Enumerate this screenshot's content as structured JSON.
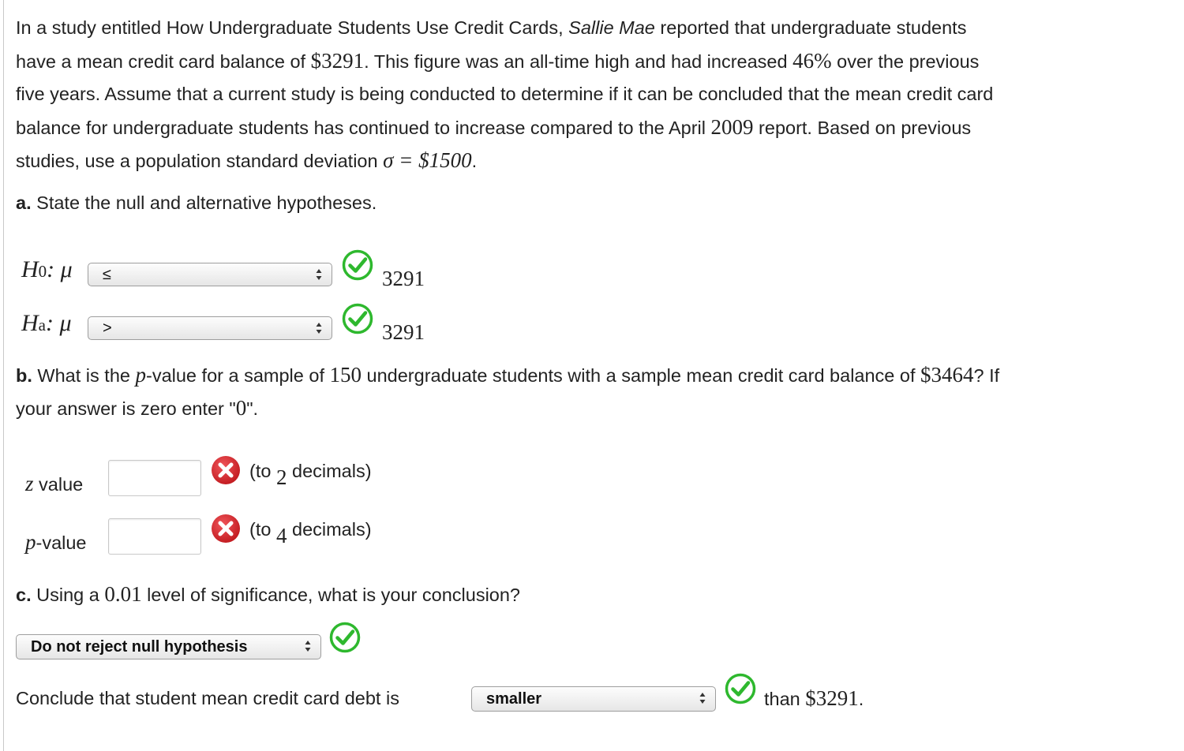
{
  "intro": {
    "l1a": "In a study entitled How Undergraduate Students Use Credit Cards, ",
    "l1b": "Sallie Mae",
    "l1c": " reported that undergraduate students",
    "l2a": "have a mean credit card balance of ",
    "l2b": "$3291",
    "l2c": ". This figure was an all-time high and had increased ",
    "l2d": "46%",
    "l2e": " over the previous",
    "l3": "five years. Assume that a current study is being conducted to determine if it can be concluded that the mean credit card",
    "l4a": "balance for undergraduate students has continued to increase compared to the April ",
    "l4b": "2009",
    "l4c": " report. Based on previous",
    "l5a": "studies, use a population standard deviation ",
    "l5b": "σ = $1500",
    "l5c": "."
  },
  "part_a": {
    "label": "a.",
    "question": " State the null and alternative hypotheses.",
    "h0": {
      "h": "H",
      "sub": "0",
      "mu": ": μ",
      "selected": "≤",
      "value": "3291",
      "status": "correct"
    },
    "ha": {
      "h": "H",
      "sub": "a",
      "mu": ": μ",
      "selected": ">",
      "value": "3291",
      "status": "correct"
    }
  },
  "part_b": {
    "label": "b.",
    "q1": " What is the ",
    "p": "p",
    "q2": "-value for a sample of ",
    "n": "150",
    "q3": " undergraduate students with a sample mean credit card balance of ",
    "mean": "$3464",
    "q4": "? If",
    "q5a": "your answer is zero enter \"",
    "q5b": "0",
    "q5c": "\".",
    "z_label_var": "z",
    "z_label": " value",
    "z_value": "",
    "z_hint_a": "(to ",
    "z_hint_n": "2",
    "z_hint_b": " decimals)",
    "z_status": "incorrect",
    "p_label_var": "p",
    "p_label": "-value",
    "p_value": "",
    "p_hint_a": "(to ",
    "p_hint_n": "4",
    "p_hint_b": " decimals)",
    "p_status": "incorrect"
  },
  "part_c": {
    "label": "c.",
    "q1": " Using a ",
    "alpha": "0.01",
    "q2": " level of significance, what is your conclusion?",
    "decision_selected": "Do not reject null hypothesis",
    "decision_status": "correct",
    "conclude_a": "Conclude that student mean credit card debt is ",
    "conclude_selected": "smaller",
    "conclude_status": "correct",
    "conclude_b": "than ",
    "conclude_amount": "$3291",
    "conclude_c": "."
  },
  "colors": {
    "correct": "#2eb82e",
    "incorrect": "#d9262b"
  },
  "icons": {
    "correct": "checkmark-circle-icon",
    "incorrect": "x-circle-icon",
    "select": "updown-arrows-icon"
  }
}
